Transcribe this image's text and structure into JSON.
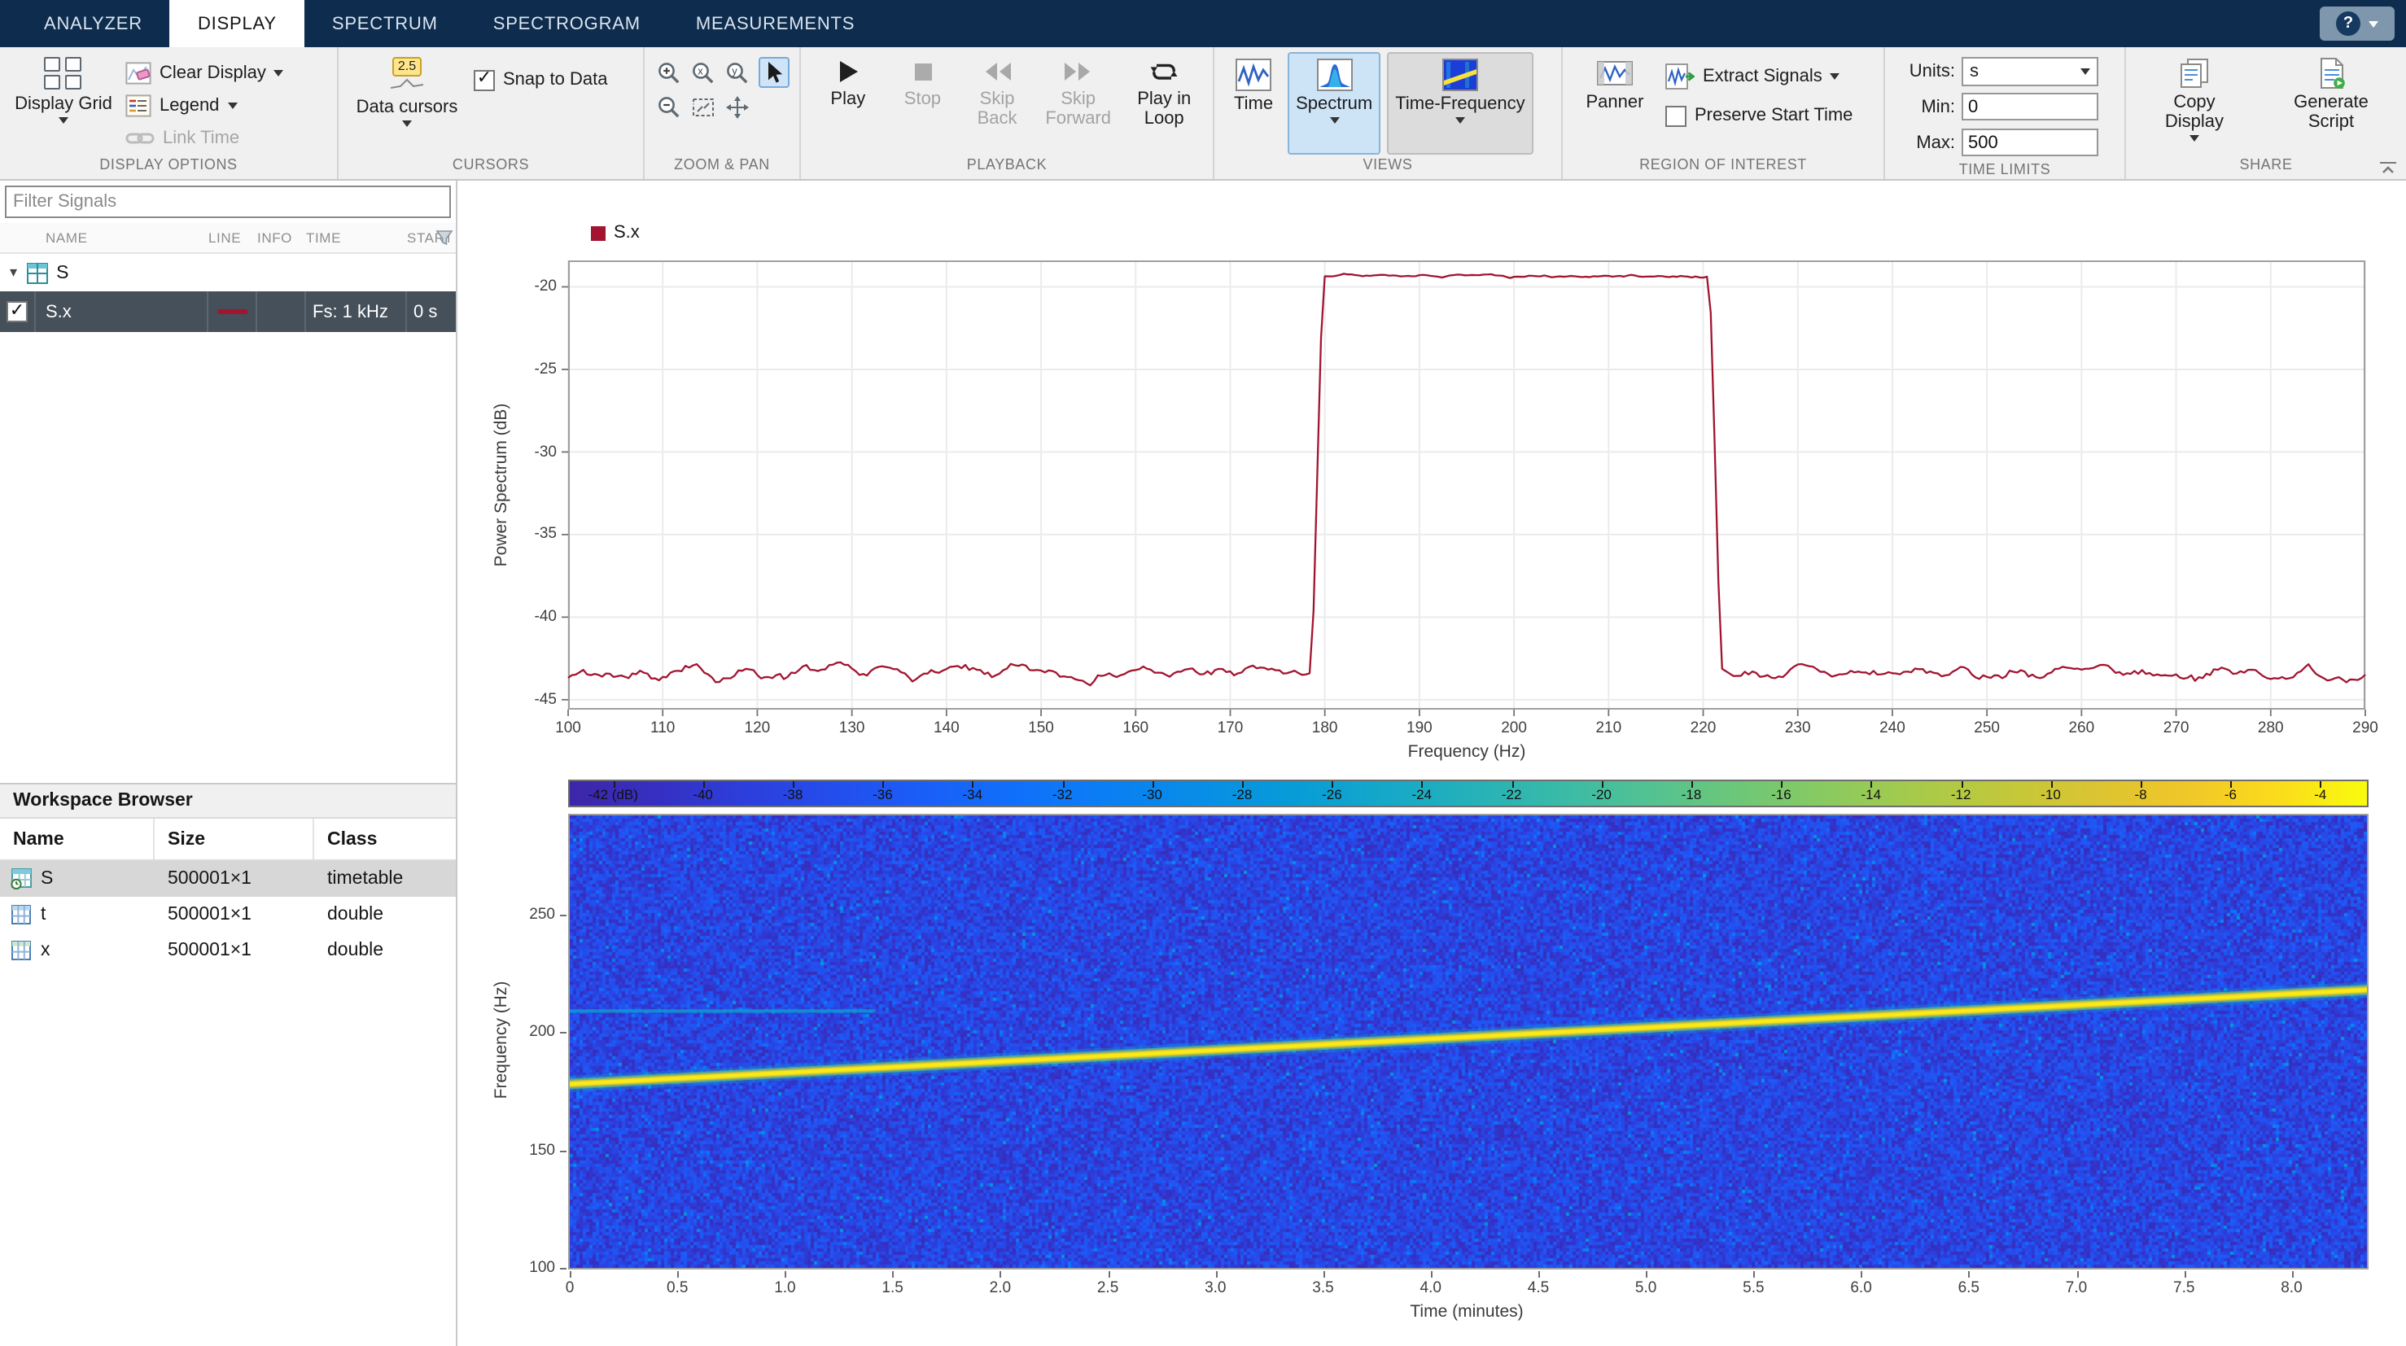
{
  "tabs": [
    {
      "label": "ANALYZER",
      "selected": false
    },
    {
      "label": "DISPLAY",
      "selected": true
    },
    {
      "label": "SPECTRUM",
      "selected": false
    },
    {
      "label": "SPECTROGRAM",
      "selected": false
    },
    {
      "label": "MEASUREMENTS",
      "selected": false
    }
  ],
  "help": {
    "glyph": "?"
  },
  "toolbar": {
    "display_options": {
      "label": "DISPLAY OPTIONS",
      "display_grid": "Display Grid",
      "clear_display": "Clear Display",
      "legend": "Legend",
      "link_time": "Link Time"
    },
    "cursors": {
      "label": "CURSORS",
      "data_cursors": "Data cursors",
      "snap_to_data": "Snap to Data",
      "snap_checked": true,
      "cursor_badge": "2.5"
    },
    "zoom_pan": {
      "label": "ZOOM & PAN"
    },
    "playback": {
      "label": "PLAYBACK",
      "play": "Play",
      "stop": "Stop",
      "skip_back": "Skip Back",
      "skip_forward": "Skip Forward",
      "play_in_loop": "Play in Loop"
    },
    "views": {
      "label": "VIEWS",
      "time": "Time",
      "spectrum": "Spectrum",
      "time_frequency": "Time-Frequency",
      "selected": "Spectrum"
    },
    "roi": {
      "label": "REGION OF INTEREST",
      "panner": "Panner",
      "extract_signals": "Extract Signals",
      "preserve_start_time": "Preserve Start Time",
      "preserve_checked": false
    },
    "time_limits": {
      "label": "TIME LIMITS",
      "units_label": "Units:",
      "units_value": "s",
      "min_label": "Min:",
      "min_value": "0",
      "max_label": "Max:",
      "max_value": "500"
    },
    "share": {
      "label": "SHARE",
      "copy_display": "Copy Display",
      "generate_script": "Generate Script"
    }
  },
  "sidebar": {
    "filter_placeholder": "Filter Signals",
    "table": {
      "columns": [
        "NAME",
        "LINE",
        "INFO",
        "TIME",
        "START"
      ]
    },
    "group": {
      "name": "S"
    },
    "signals": [
      {
        "name": "S.x",
        "checked": true,
        "line_color": "#a2142f",
        "time": "Fs: 1 kHz",
        "start": "0 s"
      }
    ],
    "workspace": {
      "title": "Workspace Browser",
      "columns": [
        "Name",
        "Size",
        "Class"
      ],
      "rows": [
        {
          "name": "S",
          "size": "500001×1",
          "class": "timetable",
          "selected": true
        },
        {
          "name": "t",
          "size": "500001×1",
          "class": "double",
          "selected": false
        },
        {
          "name": "x",
          "size": "500001×1",
          "class": "double",
          "selected": false
        }
      ]
    }
  },
  "chart_data": [
    {
      "type": "line",
      "name": "power-spectrum",
      "legend": [
        {
          "label": "S.x",
          "color": "#a2142f"
        }
      ],
      "xlabel": "Frequency (Hz)",
      "ylabel": "Power Spectrum (dB)",
      "xlim": [
        100,
        290
      ],
      "ylim": [
        -45.6,
        -18.4
      ],
      "xticks": [
        100,
        110,
        120,
        130,
        140,
        150,
        160,
        170,
        180,
        190,
        200,
        210,
        220,
        230,
        240,
        250,
        260,
        270,
        280,
        290
      ],
      "yticks": [
        -45,
        -40,
        -35,
        -30,
        -25,
        -20
      ],
      "grid": true,
      "series": [
        {
          "name": "S.x",
          "color": "#a2142f",
          "noise_floor_db": -43.4,
          "noise_amplitude_db": 0.35,
          "passband": {
            "f_start": 180,
            "f_stop": 220.5,
            "level_db": -19.35,
            "ripple_db": 0.08
          },
          "transition_hz": 1.6
        }
      ]
    },
    {
      "type": "heatmap",
      "name": "spectrogram",
      "xlabel": "Time (minutes)",
      "ylabel": "Frequency (Hz)",
      "xlim": [
        0,
        8.35
      ],
      "ylim": [
        100,
        292
      ],
      "xticks": [
        0,
        0.5,
        1,
        1.5,
        2,
        2.5,
        3,
        3.5,
        4,
        4.5,
        5,
        5.5,
        6,
        6.5,
        7,
        7.5,
        8
      ],
      "xtick_labels": [
        "0",
        "0.5",
        "1.0",
        "1.5",
        "2.0",
        "2.5",
        "3.0",
        "3.5",
        "4.0",
        "4.5",
        "5.0",
        "5.5",
        "6.0",
        "6.5",
        "7.0",
        "7.5",
        "8.0"
      ],
      "yticks": [
        100,
        150,
        200,
        250
      ],
      "colormap": "parula",
      "colorbar": {
        "min": -43,
        "max": -3,
        "unit_label": "(dB)",
        "ticks": [
          -42,
          -40,
          -38,
          -36,
          -34,
          -32,
          -30,
          -28,
          -26,
          -24,
          -22,
          -20,
          -18,
          -16,
          -14,
          -12,
          -10,
          -8,
          -6,
          -4
        ]
      },
      "noise_floor_db": {
        "mean": -38.5,
        "spread": 3.2
      },
      "chirp": {
        "t0": 0,
        "f0": 178,
        "t1": 8.35,
        "f1": 218,
        "peak_db": -4
      },
      "artifact": {
        "f": 209,
        "t0": 0,
        "t1": 1.42,
        "level_db": -26
      }
    }
  ]
}
